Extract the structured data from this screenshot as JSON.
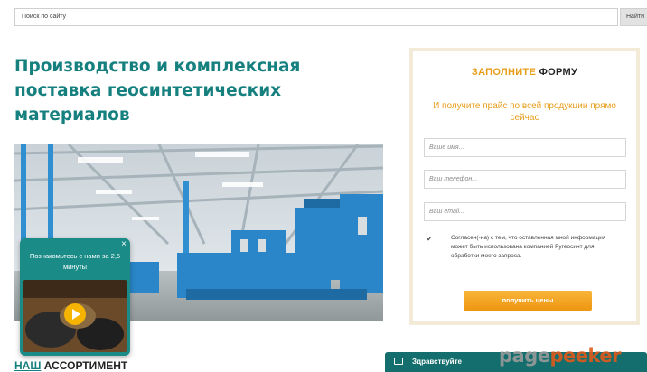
{
  "search": {
    "placeholder": "Поиск по сайту",
    "button_label": "Найти"
  },
  "hero": {
    "title_lines": [
      "Производство и комплексная",
      "поставка геосинтетических",
      "материалов"
    ]
  },
  "video_popup": {
    "text": "Познакомьтесь с нами за 2,5 минуты",
    "close": "×"
  },
  "assortment": {
    "accent": "НАШ",
    "rest": " АССОРТИМЕНТ"
  },
  "form": {
    "title_accent": "ЗАПОЛНИТЕ",
    "title_rest": " ФОРМУ",
    "subtitle": "И получите прайс по всей продукции прямо сейчас",
    "name_placeholder": "Ваше имя...",
    "phone_placeholder": "Ваш телефон...",
    "email_placeholder": "Ваш email...",
    "consent_checked": true,
    "consent_text": "Согласен(-на) с тем, что оставленная мной информация может быть использована компанией Ругеосинт для обработки моего запроса.",
    "submit_label": "получить цены"
  },
  "chat": {
    "label": "Здравствуйте"
  },
  "watermark": {
    "part1": "page",
    "part2": "peeker"
  },
  "colors": {
    "brand_teal": "#16807f",
    "accent_orange": "#e89d1a",
    "chat_bg": "#136e6d"
  }
}
